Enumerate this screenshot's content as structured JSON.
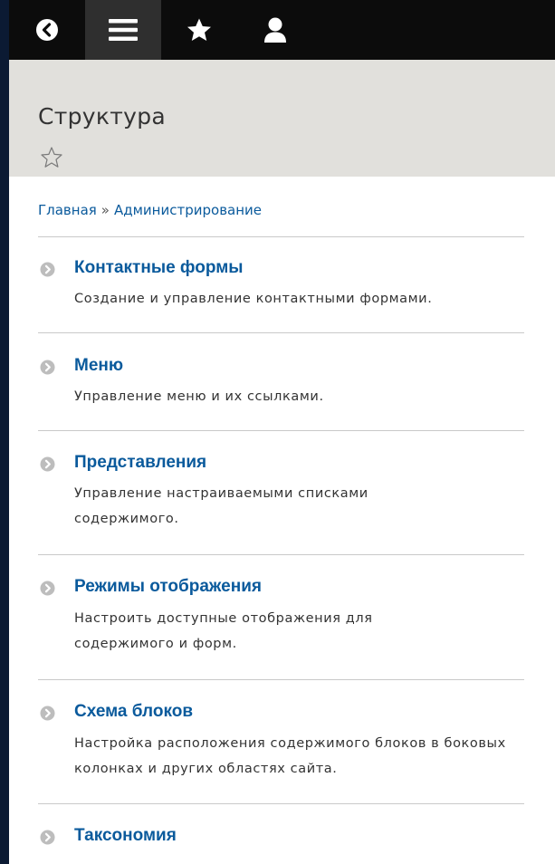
{
  "toolbar": {
    "items": [
      {
        "icon": "back-icon"
      },
      {
        "icon": "menu-icon",
        "active": true
      },
      {
        "icon": "star-icon"
      },
      {
        "icon": "user-icon"
      }
    ]
  },
  "page": {
    "title": "Структура",
    "shortcut_icon": "star-outline-icon"
  },
  "breadcrumb": {
    "items": [
      "Главная",
      "Администрирование"
    ],
    "separator": "»"
  },
  "items": [
    {
      "title": "Контактные формы",
      "description": "Создание и управление контактными формами."
    },
    {
      "title": "Меню",
      "description": "Управление меню и их ссылками."
    },
    {
      "title": "Представления",
      "description": "Управление настраиваемыми списками содержимого."
    },
    {
      "title": "Режимы отображения",
      "description": "Настроить доступные отображения для содержимого и форм."
    },
    {
      "title": "Схема блоков",
      "description": "Настройка расположения содержимого блоков в боковых колонках и других областях сайта."
    },
    {
      "title": "Таксономия",
      "description": ""
    }
  ],
  "colors": {
    "link": "#0a5a9c",
    "toolbar": "#0c0c0c",
    "header": "#e1e0dc",
    "backdrop": "#0b1a33"
  }
}
